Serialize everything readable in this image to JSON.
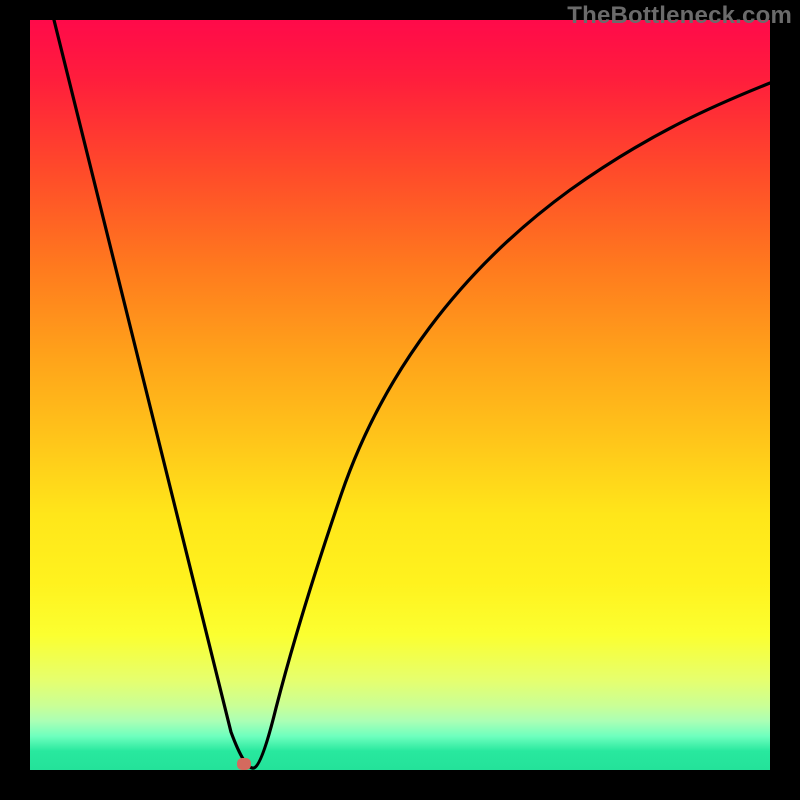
{
  "watermark": "TheBottleneck.com",
  "chart_data": {
    "type": "line",
    "title": "",
    "xlabel": "",
    "ylabel": "",
    "ylim": [
      0,
      100
    ],
    "xlim": [
      0,
      100
    ],
    "background_gradient": {
      "top": "#ff0a4a",
      "bottom": "#24e29a"
    },
    "series": [
      {
        "name": "curve",
        "x": [
          3.5,
          7,
          10,
          14,
          18,
          22,
          25,
          27,
          28,
          29,
          30,
          31,
          33,
          35,
          38,
          42,
          47,
          52,
          58,
          65,
          73,
          82,
          92,
          100
        ],
        "values": [
          100,
          88,
          76,
          63,
          50,
          37,
          25,
          15,
          8,
          3,
          0,
          3,
          12,
          24,
          37,
          50,
          61,
          69,
          76,
          82,
          86,
          89,
          91,
          92
        ]
      }
    ],
    "annotations": [
      {
        "name": "minimum-marker",
        "x": 29,
        "y": 0,
        "color": "#d46a5e"
      }
    ]
  }
}
